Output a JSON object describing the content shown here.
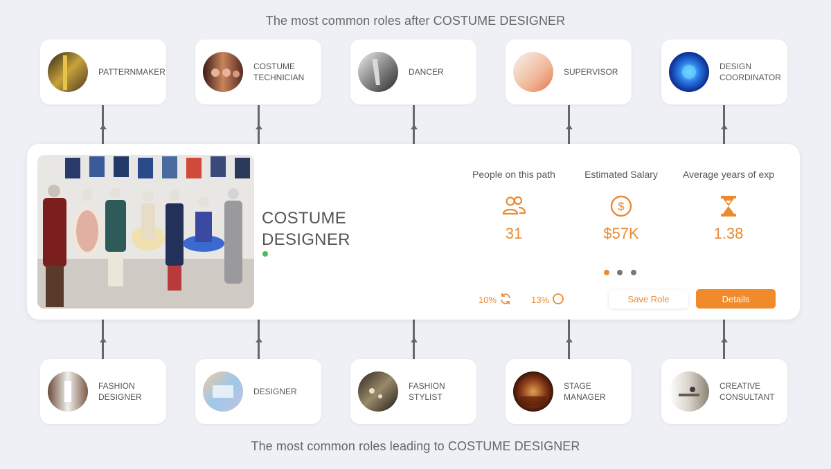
{
  "headings": {
    "after": "The most common roles after COSTUME DESIGNER",
    "leading": "The most common roles leading to COSTUME DESIGNER"
  },
  "roles_after": [
    {
      "label": "PATTERNMAKER",
      "thumb": "patternmaker-photo"
    },
    {
      "label": "COSTUME TECHNICIAN",
      "thumb": "costume-technician-photo"
    },
    {
      "label": "DANCER",
      "thumb": "dancer-photo"
    },
    {
      "label": "SUPERVISOR",
      "thumb": "supervisor-photo"
    },
    {
      "label": "DESIGN COORDINATOR",
      "thumb": "design-coordinator-photo"
    }
  ],
  "roles_before": [
    {
      "label": "FASHION DESIGNER",
      "thumb": "fashion-designer-photo"
    },
    {
      "label": "DESIGNER",
      "thumb": "designer-photo"
    },
    {
      "label": "FASHION STYLIST",
      "thumb": "fashion-stylist-photo"
    },
    {
      "label": "STAGE MANAGER",
      "thumb": "stage-manager-photo"
    },
    {
      "label": "CREATIVE CONSULTANT",
      "thumb": "creative-consultant-photo"
    }
  ],
  "main": {
    "title": "COSTUME DESIGNER",
    "stats": [
      {
        "label": "People on this path",
        "value": "31",
        "icon": "people-icon"
      },
      {
        "label": "Estimated Salary",
        "value": "$57K",
        "icon": "dollar-icon"
      },
      {
        "label": "Average years of exp",
        "value": "1.38",
        "icon": "hourglass-icon"
      }
    ],
    "pager": {
      "count": 3,
      "active": 0
    },
    "metrics": [
      {
        "value": "10%",
        "icon": "refresh-icon"
      },
      {
        "value": "13%",
        "icon": "circle-icon"
      }
    ],
    "buttons": {
      "save": "Save Role",
      "details": "Details"
    }
  },
  "colors": {
    "accent": "#f08a2b",
    "status": "#4bbf5a",
    "background": "#eef0f5",
    "connector": "#666666"
  }
}
